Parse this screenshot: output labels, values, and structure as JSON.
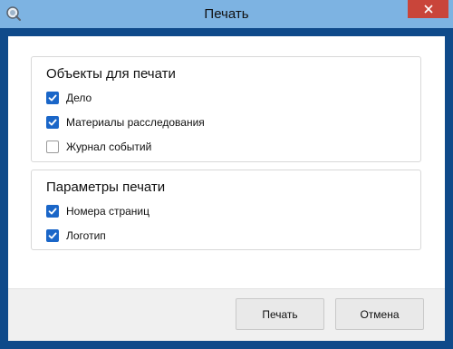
{
  "window": {
    "title": "Печать",
    "app_icon": "printer-search-icon",
    "close_icon": "close-icon",
    "colors": {
      "frame": "#0f4a8a",
      "titlebar": "#7db3e2",
      "close_button": "#c9453a",
      "checkbox_checked": "#1a66c8"
    }
  },
  "groups": [
    {
      "title": "Объекты для печати",
      "items": [
        {
          "label": "Дело",
          "checked": true
        },
        {
          "label": "Материалы расследования",
          "checked": true
        },
        {
          "label": "Журнал событий",
          "checked": false
        }
      ]
    },
    {
      "title": "Параметры печати",
      "items": [
        {
          "label": "Номера страниц",
          "checked": true
        },
        {
          "label": "Логотип",
          "checked": true
        }
      ]
    }
  ],
  "footer": {
    "print_label": "Печать",
    "cancel_label": "Отмена"
  }
}
